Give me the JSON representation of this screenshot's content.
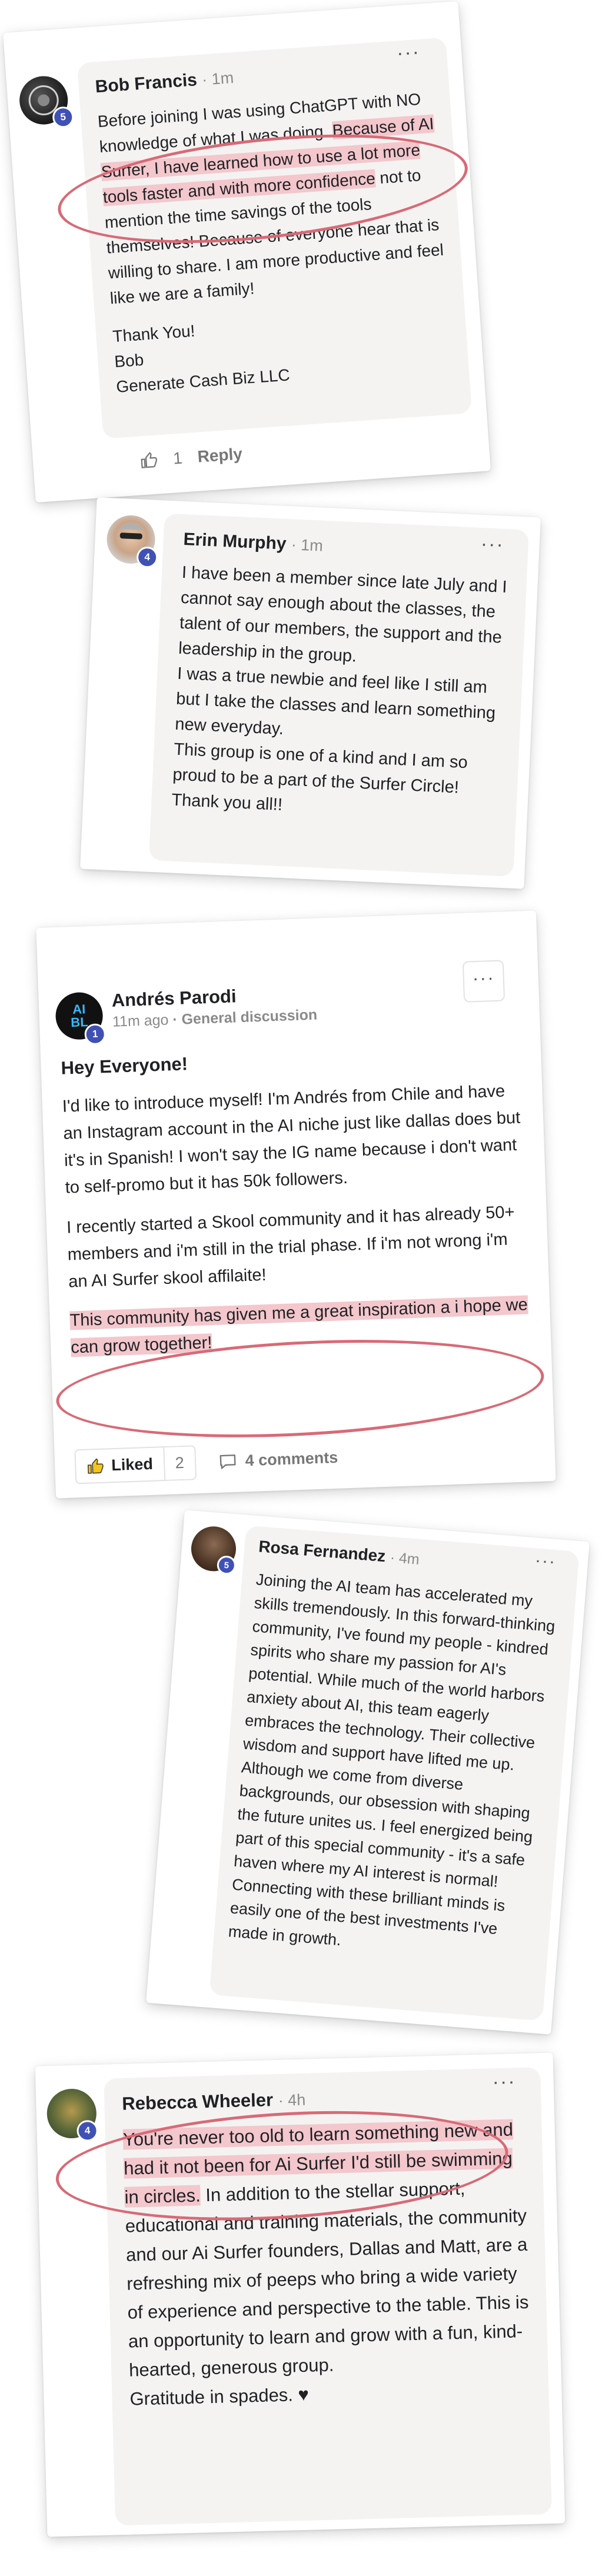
{
  "comments": [
    {
      "name": "Bob Francis",
      "time": "· 1m",
      "level": "5",
      "paragraphs": [
        {
          "pre": "Before joining I was using ChatGPT with NO knowledge of what I was doing. ",
          "hl": "Because of AI Surfer, I have learned how to use a lot more tools faster and with more confidence",
          "post": " not to mention the time savings of the tools themselves! Because of everyone hear that is willing to share. I am more productive and feel like we are a family!"
        },
        {
          "pre": "Thank You!",
          "hl": "",
          "post": ""
        },
        {
          "pre": "Bob",
          "hl": "",
          "post": ""
        },
        {
          "pre": "Generate Cash Biz LLC",
          "hl": "",
          "post": ""
        }
      ],
      "likes": "1",
      "reply": "Reply"
    },
    {
      "name": "Erin Murphy",
      "time": "· 1m",
      "level": "4",
      "paragraphs": [
        {
          "text": "I have been a member since late July and I cannot say enough about the classes, the talent of our members, the support and the leadership in the group."
        },
        {
          "text": "I was a true newbie and feel like I still am but I take the classes and learn something new everyday."
        },
        {
          "text": "This group is one of a kind and I am so proud to be a part of the Surfer Circle! Thank you all!!"
        }
      ]
    },
    {
      "name": "Andrés Parodi",
      "time": "11m ago",
      "category": "· General discussion",
      "level": "1",
      "avatar_text": "AI BL",
      "title": "Hey Everyone!",
      "para1": "I'd like to introduce myself! I'm Andrés from Chile and have an Instagram account in the AI niche just like dallas does but it's in Spanish! I won't say the IG name because i don't want to self-promo but it has 50k followers.",
      "para2": "I recently started a Skool community and it has already 50+ members and i'm still in the trial phase. If i'm not wrong i'm an AI Surfer skool affilaite!",
      "highlight": "This community has given me a great inspiration a i hope we can grow together!",
      "liked_label": "Liked",
      "like_count": "2",
      "comments_label": "4 comments"
    },
    {
      "name": "Rosa Fernandez",
      "time": "· 4m",
      "level": "5",
      "text": "Joining the AI team has accelerated my skills tremendously. In this forward-thinking community, I've found my people - kindred spirits who share my passion for AI's potential. While much of the world harbors anxiety about AI, this team eagerly embraces the technology. Their collective wisdom and support have lifted me up. Although we come from diverse backgrounds, our obsession with shaping the future unites us. I feel energized being part of this special community - it's a safe haven where my AI interest is normal! Connecting with these brilliant minds is easily one of the best investments I've made in growth."
    },
    {
      "name": "Rebecca Wheeler",
      "time": "· 4h",
      "level": "4",
      "highlight": "You're never too old to learn something new and had it not been for Ai Surfer I'd still be swimming in circles.",
      "rest": " In addition to the stellar support, educational and training materials, the community and our Ai Surfer founders, Dallas and Matt, are a refreshing mix of peeps who bring a wide variety of experience and perspective to the table. This is an opportunity to learn and grow with a fun, kind-hearted, generous group.",
      "closing": "Gratitude in spades. ♥"
    }
  ],
  "colors": {
    "highlight": "#f3c7cc",
    "ellipse": "#d86a76",
    "level_badge": "#3f51b5",
    "bubble": "#f4f3f2"
  },
  "icons": [
    "more-dots-icon",
    "thumbs-up-icon",
    "comment-bubble-icon"
  ]
}
